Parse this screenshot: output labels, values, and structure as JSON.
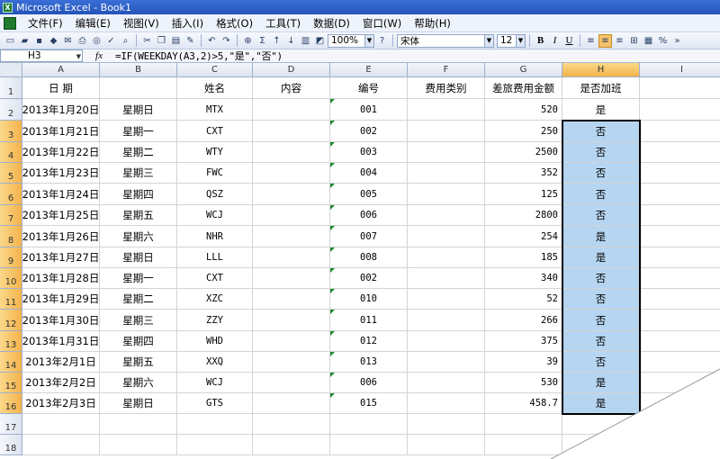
{
  "window": {
    "title": "Microsoft Excel - Book1"
  },
  "menu": [
    "文件(F)",
    "编辑(E)",
    "视图(V)",
    "插入(I)",
    "格式(O)",
    "工具(T)",
    "数据(D)",
    "窗口(W)",
    "帮助(H)"
  ],
  "toolbar": {
    "zoom": "100%",
    "font_name": "宋体",
    "font_size": "12",
    "bold": "B",
    "italic": "I",
    "underline": "U",
    "percent": "%"
  },
  "formula_bar": {
    "name_box": "H3",
    "fx": "fx",
    "formula": "=IF(WEEKDAY(A3,2)>5,\"是\",\"否\")"
  },
  "columns": [
    "A",
    "B",
    "C",
    "D",
    "E",
    "F",
    "G",
    "H",
    "I"
  ],
  "headers": {
    "date": "日  期",
    "name": "姓名",
    "content": "内容",
    "number": "编号",
    "expense_type": "费用类别",
    "amount": "差旅费用金额",
    "overtime": "是否加班"
  },
  "rows": [
    {
      "date": "2013年1月20日",
      "weekday": "星期日",
      "name": "MTX",
      "number": "001",
      "amount": "520",
      "overtime": "是"
    },
    {
      "date": "2013年1月21日",
      "weekday": "星期一",
      "name": "CXT",
      "number": "002",
      "amount": "250",
      "overtime": "否"
    },
    {
      "date": "2013年1月22日",
      "weekday": "星期二",
      "name": "WTY",
      "number": "003",
      "amount": "2500",
      "overtime": "否"
    },
    {
      "date": "2013年1月23日",
      "weekday": "星期三",
      "name": "FWC",
      "number": "004",
      "amount": "352",
      "overtime": "否"
    },
    {
      "date": "2013年1月24日",
      "weekday": "星期四",
      "name": "QSZ",
      "number": "005",
      "amount": "125",
      "overtime": "否"
    },
    {
      "date": "2013年1月25日",
      "weekday": "星期五",
      "name": "WCJ",
      "number": "006",
      "amount": "2800",
      "overtime": "否"
    },
    {
      "date": "2013年1月26日",
      "weekday": "星期六",
      "name": "NHR",
      "number": "007",
      "amount": "254",
      "overtime": "是"
    },
    {
      "date": "2013年1月27日",
      "weekday": "星期日",
      "name": "LLL",
      "number": "008",
      "amount": "185",
      "overtime": "是"
    },
    {
      "date": "2013年1月28日",
      "weekday": "星期一",
      "name": "CXT",
      "number": "002",
      "amount": "340",
      "overtime": "否"
    },
    {
      "date": "2013年1月29日",
      "weekday": "星期二",
      "name": "XZC",
      "number": "010",
      "amount": "52",
      "overtime": "否"
    },
    {
      "date": "2013年1月30日",
      "weekday": "星期三",
      "name": "ZZY",
      "number": "011",
      "amount": "266",
      "overtime": "否"
    },
    {
      "date": "2013年1月31日",
      "weekday": "星期四",
      "name": "WHD",
      "number": "012",
      "amount": "375",
      "overtime": "否"
    },
    {
      "date": "2013年2月1日",
      "weekday": "星期五",
      "name": "XXQ",
      "number": "013",
      "amount": "39",
      "overtime": "否"
    },
    {
      "date": "2013年2月2日",
      "weekday": "星期六",
      "name": "WCJ",
      "number": "006",
      "amount": "530",
      "overtime": "是"
    },
    {
      "date": "2013年2月3日",
      "weekday": "星期日",
      "name": "GTS",
      "number": "015",
      "amount": "458.7",
      "overtime": "是"
    }
  ],
  "row_numbers": [
    "1",
    "2",
    "3",
    "4",
    "5",
    "6",
    "7",
    "8",
    "9",
    "10",
    "11",
    "12",
    "13",
    "14",
    "15",
    "16",
    "17",
    "18"
  ],
  "colors": {
    "selection_fill": "#b6d5f1",
    "header_selected": "#f3b34b",
    "title_bar": "#2454b8"
  }
}
